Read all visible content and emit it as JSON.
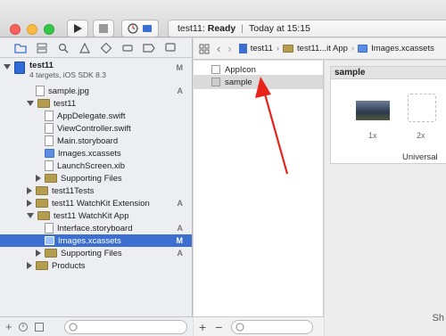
{
  "window": {
    "status_project": "test11:",
    "status_state": "Ready",
    "status_time": "Today at 15:15"
  },
  "navigator": {
    "project_name": "test11",
    "project_sub": "4 targets, iOS SDK 8.3",
    "project_badge": "M",
    "items": [
      {
        "label": "sample.jpg",
        "badge": "A"
      },
      {
        "label": "test11",
        "badge": ""
      },
      {
        "label": "AppDelegate.swift",
        "badge": ""
      },
      {
        "label": "ViewController.swift",
        "badge": ""
      },
      {
        "label": "Main.storyboard",
        "badge": ""
      },
      {
        "label": "Images.xcassets",
        "badge": ""
      },
      {
        "label": "LaunchScreen.xib",
        "badge": ""
      },
      {
        "label": "Supporting Files",
        "badge": ""
      },
      {
        "label": "test11Tests",
        "badge": ""
      },
      {
        "label": "test11 WatchKit Extension",
        "badge": "A"
      },
      {
        "label": "test11 WatchKit App",
        "badge": ""
      },
      {
        "label": "Interface.storyboard",
        "badge": "A"
      },
      {
        "label": "Images.xcassets",
        "badge": "M"
      },
      {
        "label": "Supporting Files",
        "badge": "A"
      },
      {
        "label": "Products",
        "badge": ""
      }
    ]
  },
  "jumpbar": {
    "crumb1": "test11",
    "crumb2": "test11...it App",
    "crumb3": "Images.xcassets"
  },
  "assets": {
    "items": [
      {
        "label": "AppIcon"
      },
      {
        "label": "sample"
      }
    ]
  },
  "detail": {
    "title": "sample",
    "slot1": "1x",
    "slot2": "2x",
    "device": "Universal",
    "cut_text": "Sh"
  },
  "colors": {
    "selection": "#3d6fd0",
    "arrow": "#e8231a"
  }
}
